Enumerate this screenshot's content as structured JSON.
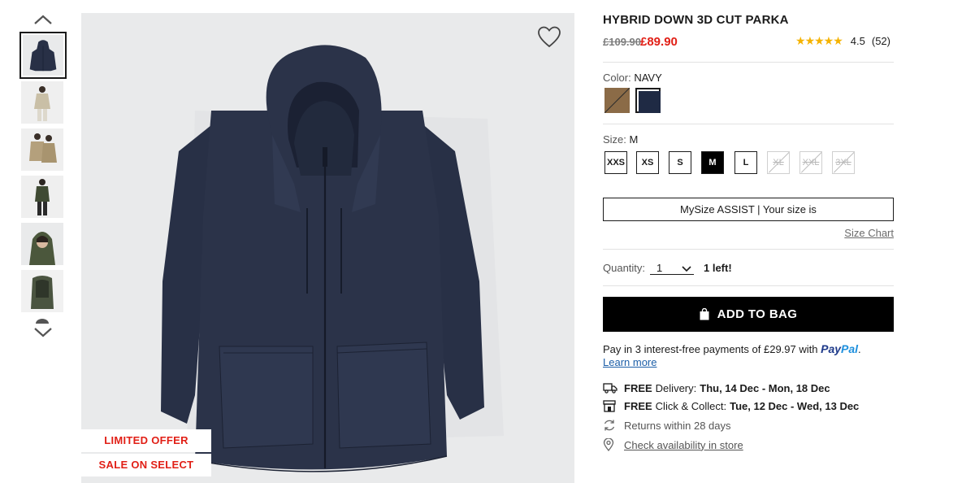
{
  "product": {
    "title": "HYBRID DOWN 3D CUT PARKA",
    "price_original": "£109.90",
    "price_sale": "£89.90",
    "rating": {
      "stars_value": 4.5,
      "stars_text": "★★★★★",
      "score": "4.5",
      "count": "(52)"
    }
  },
  "gallery": {
    "thumbnail_count": 7,
    "selected_index": 0,
    "promo_labels": [
      "LIMITED OFFER",
      "SALE ON SELECT STYLES"
    ]
  },
  "color": {
    "label": "Color:",
    "selected": "NAVY",
    "options": [
      {
        "name": "beige-swatch",
        "hex": "#8b6b47",
        "selected": false
      },
      {
        "name": "navy-swatch",
        "hex": "#1f2a44",
        "selected": true
      }
    ]
  },
  "size": {
    "label": "Size:",
    "selected": "M",
    "options": [
      {
        "label": "XXS",
        "state": "available"
      },
      {
        "label": "XS",
        "state": "available"
      },
      {
        "label": "S",
        "state": "available"
      },
      {
        "label": "M",
        "state": "selected"
      },
      {
        "label": "L",
        "state": "available"
      },
      {
        "label": "XL",
        "state": "unavailable"
      },
      {
        "label": "XXL",
        "state": "unavailable"
      },
      {
        "label": "3XL",
        "state": "unavailable"
      }
    ],
    "mysize_text": "MySize ASSIST | Your size is",
    "size_chart_link": "Size Chart"
  },
  "quantity": {
    "label": "Quantity:",
    "value": "1",
    "stock_note": "1 left!"
  },
  "cta": {
    "add_to_bag": "ADD TO BAG"
  },
  "paypal": {
    "text": "Pay in 3 interest-free payments of £29.97 with",
    "brand_pay": "Pay",
    "brand_pal": "Pal",
    "suffix": ".",
    "learn_more": "Learn more"
  },
  "delivery": {
    "home": {
      "free": "FREE",
      "label": "Delivery:",
      "dates": "Thu, 14 Dec - Mon, 18 Dec"
    },
    "collect": {
      "free": "FREE",
      "label": "Click & Collect:",
      "dates": "Tue, 12 Dec - Wed, 13 Dec"
    },
    "returns": "Returns within 28 days",
    "store_link": "Check availability in store"
  },
  "colors": {
    "sale_red": "#e11f16",
    "star_gold": "#f5b301",
    "image_bg": "#e9eaeb",
    "parka_navy": "#283046"
  }
}
